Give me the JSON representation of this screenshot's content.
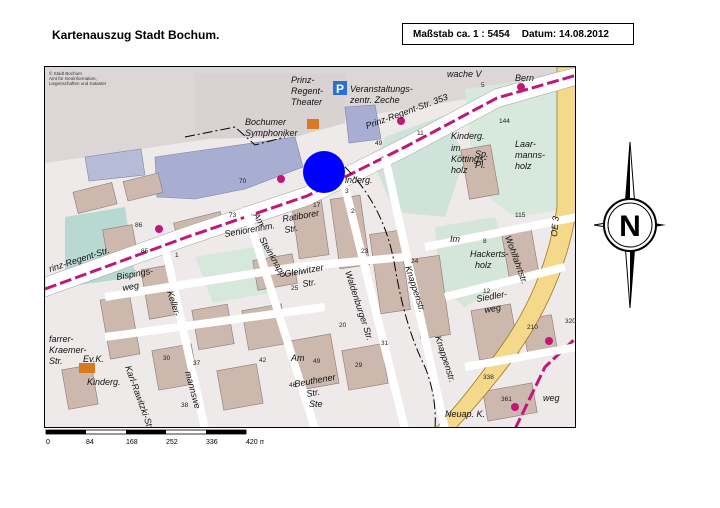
{
  "header": {
    "title": "Kartenauszug Stadt Bochum.",
    "scale_label": "Maßstab ca. 1 : 5454",
    "date_label": "Datum: 14.08.2012"
  },
  "map": {
    "copyright_lines": [
      "© Stadt Bochum",
      "Amt für Geoinformation,",
      "Liegenschaften und Kataster"
    ],
    "marker_color": "#0000ff",
    "labels": [
      {
        "text": "Prinz-"
      },
      {
        "text": "Regent-"
      },
      {
        "text": "Theater"
      },
      {
        "text": "Veranstaltungs-"
      },
      {
        "text": "zentr. Zeche"
      },
      {
        "text": "Bochumer"
      },
      {
        "text": "Symphoniker"
      },
      {
        "text": "Prinz-Regent-Str. 353"
      },
      {
        "text": "Kinderg."
      },
      {
        "text": "im"
      },
      {
        "text": "Köttings-"
      },
      {
        "text": "holz"
      },
      {
        "text": "Sp."
      },
      {
        "text": "Pl."
      },
      {
        "text": "Laar-"
      },
      {
        "text": "manns-"
      },
      {
        "text": "holz"
      },
      {
        "text": "inderg."
      },
      {
        "text": "Ratiborer"
      },
      {
        "text": "Str."
      },
      {
        "text": "Seniorenhm."
      },
      {
        "text": "Am"
      },
      {
        "text": "Steinknapp"
      },
      {
        "text": "Gleiwitzer"
      },
      {
        "text": "Str."
      },
      {
        "text": "Waldenburger Str."
      },
      {
        "text": "Knappenstr."
      },
      {
        "text": "Knappenstr."
      },
      {
        "text": "Im"
      },
      {
        "text": "Hackerts-"
      },
      {
        "text": "holz"
      },
      {
        "text": "Wohlfahrtstr."
      },
      {
        "text": "Siedler-"
      },
      {
        "text": "weg"
      },
      {
        "text": "Bispings-"
      },
      {
        "text": "weg"
      },
      {
        "text": "Keller-"
      },
      {
        "text": "mannswe"
      },
      {
        "text": "Am"
      },
      {
        "text": "Ste"
      },
      {
        "text": "Beuthener"
      },
      {
        "text": "Str."
      },
      {
        "text": "Ev.K."
      },
      {
        "text": "Kinderg."
      },
      {
        "text": "Karl-Rawitzki-Str."
      },
      {
        "text": "farrer-"
      },
      {
        "text": "Kraemer-"
      },
      {
        "text": "Str."
      },
      {
        "text": "Neuap. K."
      },
      {
        "text": "weg"
      },
      {
        "text": "rinz-Regent-Str."
      },
      {
        "text": "wache V"
      },
      {
        "text": "Bern"
      },
      {
        "text": "OE 3"
      }
    ],
    "house_numbers": [
      "5",
      "144",
      "49",
      "70",
      "73",
      "2",
      "17",
      "86",
      "85",
      "1",
      "23",
      "24",
      "25",
      "8",
      "115",
      "12",
      "210",
      "320",
      "20",
      "31",
      "30",
      "37",
      "42",
      "29",
      "338",
      "361",
      "38",
      "49",
      "46",
      "11",
      "3"
    ]
  },
  "scalebar": {
    "ticks": [
      "0",
      "84",
      "168",
      "252",
      "336",
      "420"
    ],
    "unit": "m"
  },
  "compass": {
    "letter": "N"
  }
}
